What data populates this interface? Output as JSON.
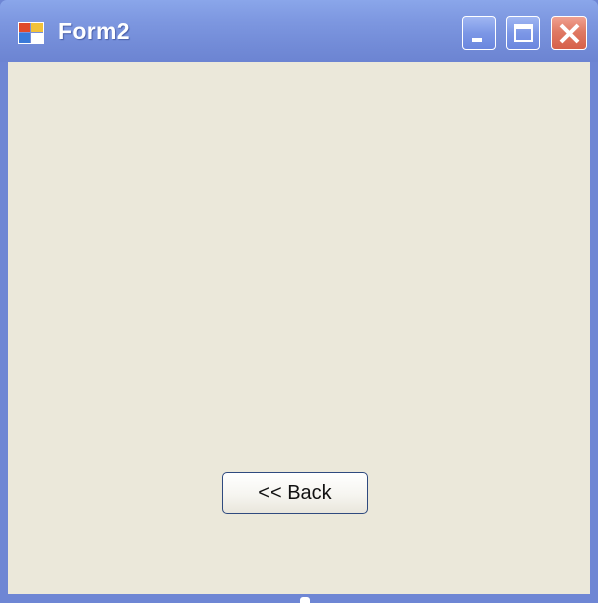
{
  "window": {
    "title": "Form2",
    "controls": [
      "minimize",
      "maximize",
      "close"
    ]
  },
  "content": {
    "back_button_label": "<< Back"
  },
  "icons": {
    "app": "app-form-icon",
    "minimize": "minimize-icon",
    "maximize": "maximize-icon",
    "close": "close-icon"
  },
  "colors": {
    "titlebar": "#7d97e0",
    "client_background": "#ebe8da",
    "close_button": "#e07a64"
  }
}
